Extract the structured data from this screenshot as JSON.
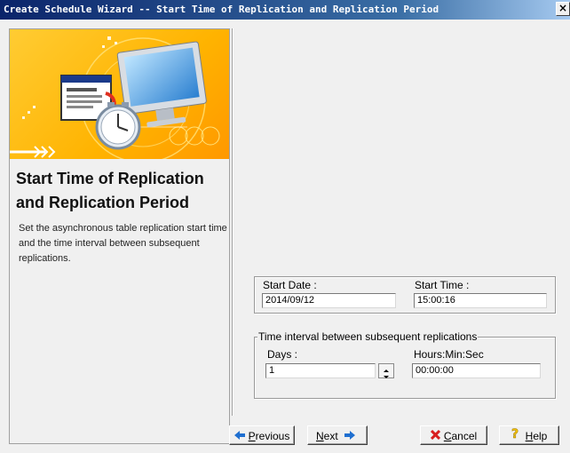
{
  "window": {
    "title": "Create Schedule Wizard -- Start Time of Replication and Replication Period",
    "close_glyph": "×"
  },
  "left_panel": {
    "step_title": "Start Time of Replication and Replication Period",
    "step_description": "Set the asynchronous table replication start time and the time interval between subsequent replications."
  },
  "start": {
    "date_label": "Start Date :",
    "date_value": "2014/09/12",
    "time_label": "Start Time :",
    "time_value": "15:00:16"
  },
  "interval": {
    "legend": "Time interval between subsequent replications",
    "days_label": "Days :",
    "days_value": "1",
    "hms_label": "Hours:Min:Sec",
    "hms_value": "00:00:00"
  },
  "buttons": {
    "previous": {
      "mnemonic": "P",
      "rest": "revious",
      "icon": "arrow-left-icon",
      "icon_color": "#1f6fd0"
    },
    "next": {
      "mnemonic": "N",
      "rest": "ext",
      "icon": "arrow-right-icon",
      "icon_color": "#1f6fd0"
    },
    "cancel": {
      "mnemonic": "C",
      "rest": "ancel",
      "icon": "x-icon",
      "icon_color": "#d81e1e"
    },
    "help": {
      "mnemonic": "H",
      "rest": "elp",
      "icon": "question-icon",
      "icon_color": "#f0c000"
    }
  }
}
